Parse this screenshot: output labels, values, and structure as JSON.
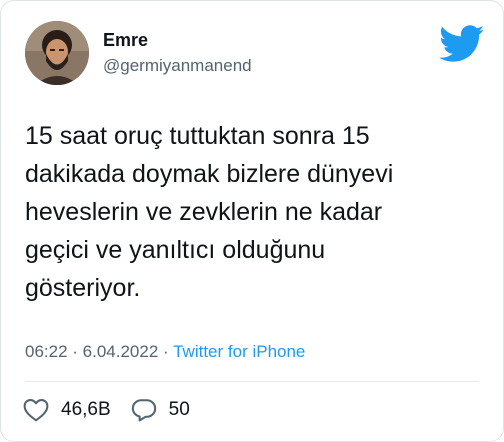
{
  "author": {
    "name": "Emre",
    "handle": "@germiyanmanend"
  },
  "tweet": {
    "text": "15 saat oruç tuttuktan sonra 15\ndakikada doymak bizlere dünyevi\nheveslerin ve zevklerin ne kadar\ngeçici ve yanıltıcı olduğunu\ngösteriyor."
  },
  "meta": {
    "time": "06:22",
    "separator1": " · ",
    "date": "6.04.2022",
    "separator2": " · ",
    "source": "Twitter for iPhone"
  },
  "actions": {
    "likes": "46,6B",
    "replies": "50"
  },
  "icons": {
    "brand": "twitter-bird-icon",
    "like": "heart-icon",
    "reply": "speech-bubble-icon"
  },
  "colors": {
    "brand": "#1d9bf0",
    "text": "#0f1419",
    "muted": "#536471"
  }
}
